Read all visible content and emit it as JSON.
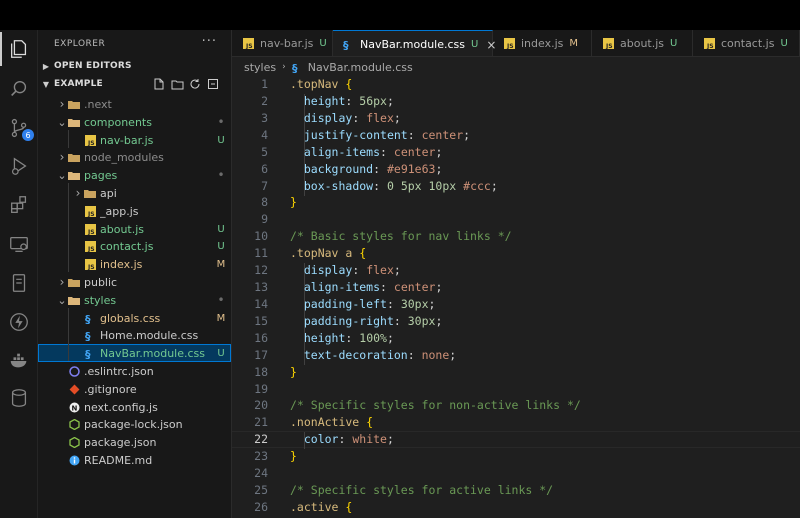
{
  "colors": {
    "accent": "#0078d4",
    "untracked": "#73c991",
    "modified": "#e2c08d"
  },
  "activity_bar": [
    {
      "icon": "explorer-icon",
      "active": true
    },
    {
      "icon": "search-icon"
    },
    {
      "icon": "source-control-icon",
      "badge": "6"
    },
    {
      "icon": "run-debug-icon"
    },
    {
      "icon": "extensions-icon"
    },
    {
      "icon": "remote-explorer-icon"
    },
    {
      "icon": "testing-icon"
    },
    {
      "icon": "thunder-client-icon"
    },
    {
      "icon": "docker-icon"
    },
    {
      "icon": "database-icon"
    }
  ],
  "sidebar": {
    "title": "EXPLORER",
    "more": "···",
    "open_editors": "OPEN EDITORS",
    "project": "EXAMPLE",
    "tree": [
      {
        "name": ".next",
        "kind": "folder",
        "expanded": false,
        "status": "",
        "dim": true
      },
      {
        "name": "components",
        "kind": "folder",
        "expanded": true,
        "status": "•",
        "color": "green"
      },
      {
        "name": "nav-bar.js",
        "kind": "js",
        "status": "U",
        "color": "green"
      },
      {
        "name": "node_modules",
        "kind": "folder",
        "expanded": false,
        "status": "",
        "dim": true
      },
      {
        "name": "pages",
        "kind": "folder",
        "expanded": true,
        "status": "•",
        "color": "green"
      },
      {
        "name": "api",
        "kind": "folder",
        "expanded": false,
        "status": ""
      },
      {
        "name": "_app.js",
        "kind": "js",
        "status": ""
      },
      {
        "name": "about.js",
        "kind": "js",
        "status": "U",
        "color": "green"
      },
      {
        "name": "contact.js",
        "kind": "js",
        "status": "U",
        "color": "green"
      },
      {
        "name": "index.js",
        "kind": "js",
        "status": "M",
        "color": "yellow"
      },
      {
        "name": "public",
        "kind": "folder",
        "expanded": false,
        "status": ""
      },
      {
        "name": "styles",
        "kind": "folder",
        "expanded": true,
        "status": "•",
        "color": "green"
      },
      {
        "name": "globals.css",
        "kind": "css",
        "status": "M",
        "color": "yellow"
      },
      {
        "name": "Home.module.css",
        "kind": "css",
        "status": ""
      },
      {
        "name": "NavBar.module.css",
        "kind": "css",
        "status": "U",
        "color": "green",
        "selected": true
      },
      {
        "name": ".eslintrc.json",
        "kind": "eslint",
        "status": ""
      },
      {
        "name": ".gitignore",
        "kind": "git",
        "status": ""
      },
      {
        "name": "next.config.js",
        "kind": "next",
        "status": ""
      },
      {
        "name": "package-lock.json",
        "kind": "npm",
        "status": ""
      },
      {
        "name": "package.json",
        "kind": "npm",
        "status": ""
      },
      {
        "name": "README.md",
        "kind": "info",
        "status": ""
      }
    ]
  },
  "tabs": [
    {
      "label": "nav-bar.js",
      "kind": "js",
      "status": "U"
    },
    {
      "label": "NavBar.module.css",
      "kind": "css",
      "status": "U",
      "active": true,
      "close": "×"
    },
    {
      "label": "index.js",
      "kind": "js",
      "status": "M"
    },
    {
      "label": "about.js",
      "kind": "js",
      "status": "U"
    },
    {
      "label": "contact.js",
      "kind": "js",
      "status": "U"
    }
  ],
  "breadcrumb": {
    "folder": "styles",
    "sep": "›",
    "file": "NavBar.module.css"
  },
  "editor": {
    "current_line": 22,
    "lines": [
      {
        "n": "1",
        "tokens": [
          [
            "sel",
            ".topNav "
          ],
          [
            "brace",
            "{"
          ]
        ]
      },
      {
        "n": "2",
        "tokens": [
          [
            "punc",
            "  "
          ],
          [
            "prop",
            "height"
          ],
          [
            "punc",
            ": "
          ],
          [
            "num",
            "56px"
          ],
          [
            "punc",
            ";"
          ]
        ]
      },
      {
        "n": "3",
        "tokens": [
          [
            "punc",
            "  "
          ],
          [
            "prop",
            "display"
          ],
          [
            "punc",
            ": "
          ],
          [
            "val",
            "flex"
          ],
          [
            "punc",
            ";"
          ]
        ]
      },
      {
        "n": "4",
        "tokens": [
          [
            "punc",
            "  "
          ],
          [
            "prop",
            "justify-content"
          ],
          [
            "punc",
            ": "
          ],
          [
            "val",
            "center"
          ],
          [
            "punc",
            ";"
          ]
        ]
      },
      {
        "n": "5",
        "tokens": [
          [
            "punc",
            "  "
          ],
          [
            "prop",
            "align-items"
          ],
          [
            "punc",
            ": "
          ],
          [
            "val",
            "center"
          ],
          [
            "punc",
            ";"
          ]
        ]
      },
      {
        "n": "6",
        "tokens": [
          [
            "punc",
            "  "
          ],
          [
            "prop",
            "background"
          ],
          [
            "punc",
            ": "
          ],
          [
            "val",
            "#e91e63"
          ],
          [
            "punc",
            ";"
          ]
        ]
      },
      {
        "n": "7",
        "tokens": [
          [
            "punc",
            "  "
          ],
          [
            "prop",
            "box-shadow"
          ],
          [
            "punc",
            ": "
          ],
          [
            "num",
            "0 5px 10px"
          ],
          [
            "punc",
            " "
          ],
          [
            "val",
            "#ccc"
          ],
          [
            "punc",
            ";"
          ]
        ]
      },
      {
        "n": "8",
        "tokens": [
          [
            "brace",
            "}"
          ]
        ]
      },
      {
        "n": "9",
        "tokens": []
      },
      {
        "n": "10",
        "tokens": [
          [
            "com",
            "/* Basic styles for nav links */"
          ]
        ]
      },
      {
        "n": "11",
        "tokens": [
          [
            "sel",
            ".topNav a "
          ],
          [
            "brace",
            "{"
          ]
        ]
      },
      {
        "n": "12",
        "tokens": [
          [
            "punc",
            "  "
          ],
          [
            "prop",
            "display"
          ],
          [
            "punc",
            ": "
          ],
          [
            "val",
            "flex"
          ],
          [
            "punc",
            ";"
          ]
        ]
      },
      {
        "n": "13",
        "tokens": [
          [
            "punc",
            "  "
          ],
          [
            "prop",
            "align-items"
          ],
          [
            "punc",
            ": "
          ],
          [
            "val",
            "center"
          ],
          [
            "punc",
            ";"
          ]
        ]
      },
      {
        "n": "14",
        "tokens": [
          [
            "punc",
            "  "
          ],
          [
            "prop",
            "padding-left"
          ],
          [
            "punc",
            ": "
          ],
          [
            "num",
            "30px"
          ],
          [
            "punc",
            ";"
          ]
        ]
      },
      {
        "n": "15",
        "tokens": [
          [
            "punc",
            "  "
          ],
          [
            "prop",
            "padding-right"
          ],
          [
            "punc",
            ": "
          ],
          [
            "num",
            "30px"
          ],
          [
            "punc",
            ";"
          ]
        ]
      },
      {
        "n": "16",
        "tokens": [
          [
            "punc",
            "  "
          ],
          [
            "prop",
            "height"
          ],
          [
            "punc",
            ": "
          ],
          [
            "num",
            "100%"
          ],
          [
            "punc",
            ";"
          ]
        ]
      },
      {
        "n": "17",
        "tokens": [
          [
            "punc",
            "  "
          ],
          [
            "prop",
            "text-decoration"
          ],
          [
            "punc",
            ": "
          ],
          [
            "val",
            "none"
          ],
          [
            "punc",
            ";"
          ]
        ]
      },
      {
        "n": "18",
        "tokens": [
          [
            "brace",
            "}"
          ]
        ]
      },
      {
        "n": "19",
        "tokens": []
      },
      {
        "n": "20",
        "tokens": [
          [
            "com",
            "/* Specific styles for non-active links */"
          ]
        ]
      },
      {
        "n": "21",
        "tokens": [
          [
            "sel",
            ".nonActive "
          ],
          [
            "brace",
            "{"
          ]
        ]
      },
      {
        "n": "22",
        "tokens": [
          [
            "punc",
            "  "
          ],
          [
            "prop",
            "color"
          ],
          [
            "punc",
            ": "
          ],
          [
            "val",
            "white"
          ],
          [
            "punc",
            ";"
          ]
        ]
      },
      {
        "n": "23",
        "tokens": [
          [
            "brace",
            "}"
          ]
        ]
      },
      {
        "n": "24",
        "tokens": []
      },
      {
        "n": "25",
        "tokens": [
          [
            "com",
            "/* Specific styles for active links */"
          ]
        ]
      },
      {
        "n": "26",
        "tokens": [
          [
            "sel",
            ".active "
          ],
          [
            "brace",
            "{"
          ]
        ]
      }
    ]
  }
}
